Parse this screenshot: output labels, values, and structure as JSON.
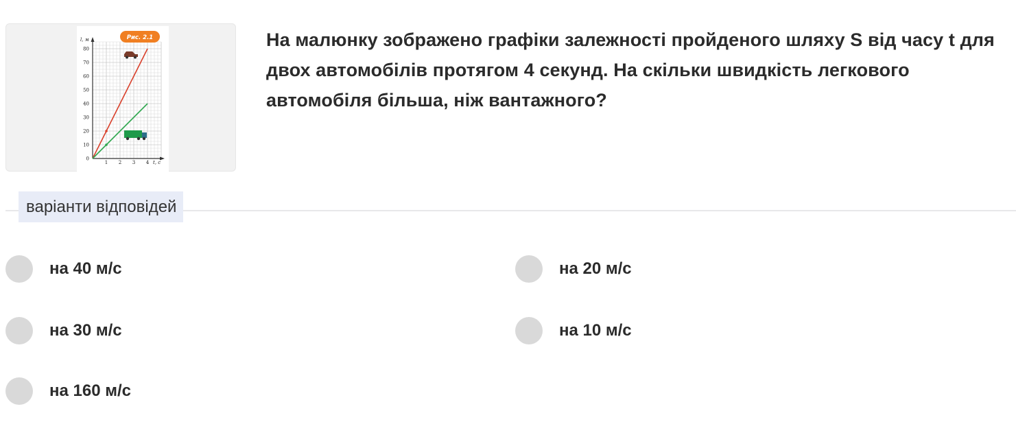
{
  "question": {
    "text": "На малюнку зображено графіки залежності пройденого шляху S від часу t для двох автомобілів протягом 4 секунд. На скільки швидкість легкового автомобіля більша, ніж вантажного?"
  },
  "figure": {
    "badge": "Рис. 2.1",
    "y_axis_label": "l, м",
    "x_axis_label": "t, с",
    "y_ticks": [
      "80",
      "70",
      "60",
      "50",
      "40",
      "30",
      "20",
      "10",
      "0"
    ],
    "x_ticks": [
      "1",
      "2",
      "3",
      "4"
    ],
    "colors": {
      "car_line": "#d9402b",
      "truck_line": "#2fa84f",
      "badge": "#f07f22",
      "truck_icon": "#1f9a4a",
      "car_icon": "#7a3b2a"
    },
    "icons": {
      "car": "car-icon",
      "truck": "truck-icon"
    }
  },
  "answers": {
    "section_label": "варіанти відповідей",
    "options": [
      {
        "label": "на 40 м/с"
      },
      {
        "label": "на 20 м/с"
      },
      {
        "label": "на 30 м/с"
      },
      {
        "label": "на 10 м/с"
      },
      {
        "label": "на 160 м/с"
      }
    ]
  }
}
